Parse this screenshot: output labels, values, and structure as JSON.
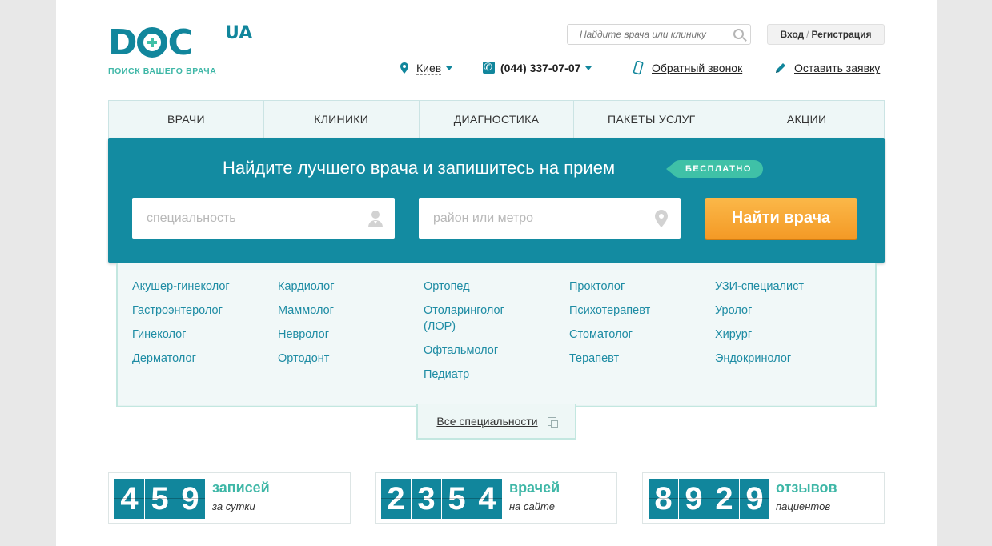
{
  "logo": {
    "word": "DOC",
    "suffix": "UA",
    "tagline": "ПОИСК ВАШЕГО ВРАЧА"
  },
  "header": {
    "search_placeholder": "Найдите врача или клинику",
    "login": "Вход",
    "register": "Регистрация",
    "city": "Киев",
    "phone": "(044) 337-07-07",
    "callback": "Обратный звонок",
    "request": "Оставить заявку"
  },
  "nav": [
    {
      "label": "ВРАЧИ"
    },
    {
      "label": "КЛИНИКИ"
    },
    {
      "label": "ДИАГНОСТИКА"
    },
    {
      "label": "ПАКЕТЫ УСЛУГ"
    },
    {
      "label": "АКЦИИ"
    }
  ],
  "hero": {
    "title": "Найдите лучшего врача и запишитесь на прием",
    "badge": "БЕСПЛАТНО",
    "specialty_placeholder": "специальность",
    "location_placeholder": "район или метро",
    "button": "Найти врача"
  },
  "specialties": [
    [
      "Акушер-гинеколог",
      "Гастроэнтеролог",
      "Гинеколог",
      "Дерматолог"
    ],
    [
      "Кардиолог",
      "Маммолог",
      "Невролог",
      "Ортодонт"
    ],
    [
      "Ортопед",
      "Отоларинголог (ЛОР)",
      "Офтальмолог",
      "Педиатр"
    ],
    [
      "Проктолог",
      "Психотерапевт",
      "Стоматолог",
      "Терапевт"
    ],
    [
      "УЗИ-специалист",
      "Уролог",
      "Хирург",
      "Эндокринолог"
    ]
  ],
  "all_specialties": "Все специальности",
  "stats": [
    {
      "digits": [
        "4",
        "5",
        "9"
      ],
      "label": "записей",
      "sub": "за сутки"
    },
    {
      "digits": [
        "2",
        "3",
        "5",
        "4"
      ],
      "label": "врачей",
      "sub": "на сайте"
    },
    {
      "digits": [
        "8",
        "9",
        "2",
        "9"
      ],
      "label": "отзывов",
      "sub": "пациентов"
    }
  ],
  "colors": {
    "brand": "#11869c",
    "accent": "#3fc1a7",
    "button": "#f7a733"
  }
}
